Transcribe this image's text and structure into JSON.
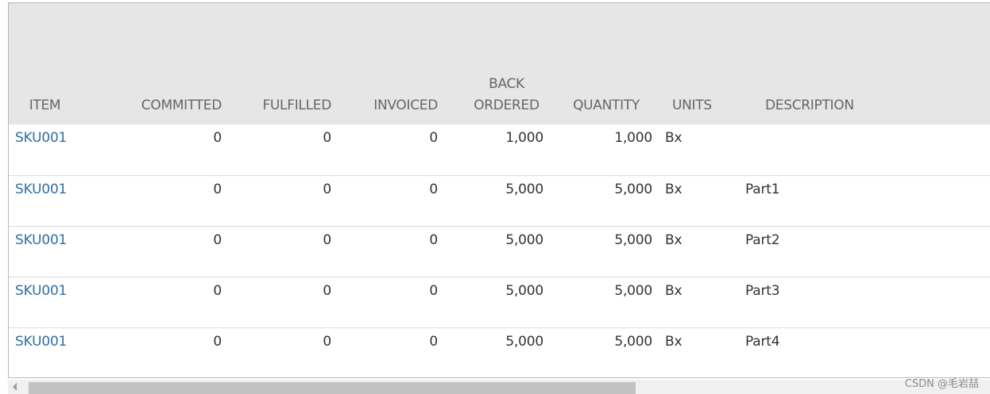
{
  "table": {
    "headers": {
      "item": "ITEM",
      "committed": "COMMITTED",
      "fulfilled": "FULFILLED",
      "invoiced": "INVOICED",
      "back_ordered_line1": "BACK",
      "back_ordered_line2": "ORDERED",
      "quantity": "QUANTITY",
      "units": "UNITS",
      "description": "DESCRIPTION"
    },
    "rows": [
      {
        "item": "SKU001",
        "committed": "0",
        "fulfilled": "0",
        "invoiced": "0",
        "back_ordered": "1,000",
        "quantity": "1,000",
        "units": "Bx",
        "description": ""
      },
      {
        "item": "SKU001",
        "committed": "0",
        "fulfilled": "0",
        "invoiced": "0",
        "back_ordered": "5,000",
        "quantity": "5,000",
        "units": "Bx",
        "description": "Part1"
      },
      {
        "item": "SKU001",
        "committed": "0",
        "fulfilled": "0",
        "invoiced": "0",
        "back_ordered": "5,000",
        "quantity": "5,000",
        "units": "Bx",
        "description": "Part2"
      },
      {
        "item": "SKU001",
        "committed": "0",
        "fulfilled": "0",
        "invoiced": "0",
        "back_ordered": "5,000",
        "quantity": "5,000",
        "units": "Bx",
        "description": "Part3"
      },
      {
        "item": "SKU001",
        "committed": "0",
        "fulfilled": "0",
        "invoiced": "0",
        "back_ordered": "5,000",
        "quantity": "5,000",
        "units": "Bx",
        "description": "Part4"
      }
    ]
  },
  "colors": {
    "header_bg": "#e6e6e6",
    "link": "#2f6ea5",
    "row_divider": "#dcdcdc"
  },
  "watermark": "CSDN @毛岩喆",
  "scrollbar": {
    "left_arrow_icon": "triangle-left-icon"
  }
}
